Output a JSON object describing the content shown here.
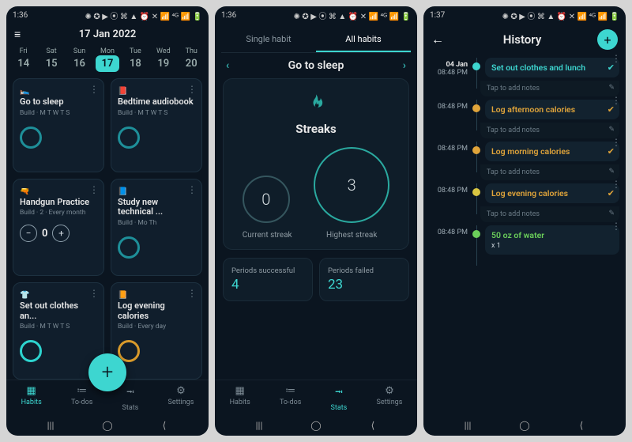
{
  "statusbar": {
    "time1": "1:36",
    "time2": "1:36",
    "time3": "1:37",
    "icons": "✺ ✪ ▶ ⦿ ⌘ ▲   ⏰ ✕ 📶 ⁴ᴳ 📶 🔋"
  },
  "screen1": {
    "title": "17 Jan 2022",
    "days": [
      {
        "dn": "Fri",
        "dd": "14"
      },
      {
        "dn": "Sat",
        "dd": "15"
      },
      {
        "dn": "Sun",
        "dd": "16"
      },
      {
        "dn": "Mon",
        "dd": "17",
        "sel": true
      },
      {
        "dn": "Tue",
        "dd": "18"
      },
      {
        "dn": "Wed",
        "dd": "19"
      },
      {
        "dn": "Thu",
        "dd": "20"
      }
    ],
    "cards": [
      {
        "emoji": "🛌",
        "title": "Go to sleep",
        "sub": "Build · M T W T S",
        "ring": "teal"
      },
      {
        "emoji": "📕",
        "title": "Bedtime audiobook",
        "sub": "Build · M T W T S",
        "ring": "teal"
      },
      {
        "emoji": "🔫",
        "title": "Handgun Practice",
        "sub": "Build · 2 · Every month",
        "counter": "0"
      },
      {
        "emoji": "📘",
        "title": "Study new technical ...",
        "sub": "Build · Mo Th",
        "ring": "teal"
      },
      {
        "emoji": "👕",
        "title": "Set out clothes an...",
        "sub": "Build · M T W T S",
        "ring": "cyan"
      },
      {
        "emoji": "📙",
        "title": "Log evening calories",
        "sub": "Build · Every day",
        "ring": "orange"
      }
    ],
    "nav": [
      {
        "ic": "▦",
        "label": "Habits",
        "active": true
      },
      {
        "ic": "≔",
        "label": "To-dos"
      },
      {
        "ic": "⭲",
        "label": "Stats"
      },
      {
        "ic": "⚙",
        "label": "Settings"
      }
    ]
  },
  "screen2": {
    "tabs": [
      {
        "label": "Single habit"
      },
      {
        "label": "All habits",
        "active": true
      }
    ],
    "title": "Go to sleep",
    "streaks_label": "Streaks",
    "current": {
      "value": "0",
      "label": "Current streak"
    },
    "highest": {
      "value": "3",
      "label": "Highest streak"
    },
    "periods_success": {
      "label": "Periods successful",
      "value": "4"
    },
    "periods_fail": {
      "label": "Periods failed",
      "value": "23"
    },
    "nav": [
      {
        "ic": "▦",
        "label": "Habits"
      },
      {
        "ic": "≔",
        "label": "To-dos"
      },
      {
        "ic": "⭲",
        "label": "Stats",
        "active": true
      },
      {
        "ic": "⚙",
        "label": "Settings"
      }
    ]
  },
  "screen3": {
    "title": "History",
    "date_label": "04 Jan",
    "tap_notes": "Tap to add notes",
    "items": [
      {
        "time": "08:48 PM",
        "title": "Set out clothes and lunch",
        "color": "cyan",
        "dot": "cyan",
        "check": true,
        "showDate": true
      },
      {
        "time": "08:48 PM",
        "title": "Log afternoon calories",
        "color": "orange",
        "dot": "orange",
        "check": true
      },
      {
        "time": "08:48 PM",
        "title": "Log morning calories",
        "color": "orange",
        "dot": "orange",
        "check": true
      },
      {
        "time": "08:48 PM",
        "title": "Log evening calories",
        "color": "orange",
        "dot": "yellow",
        "check": true
      },
      {
        "time": "08:48 PM",
        "title": "50 oz of water",
        "sub": "x 1",
        "color": "green",
        "dot": "green"
      }
    ]
  }
}
